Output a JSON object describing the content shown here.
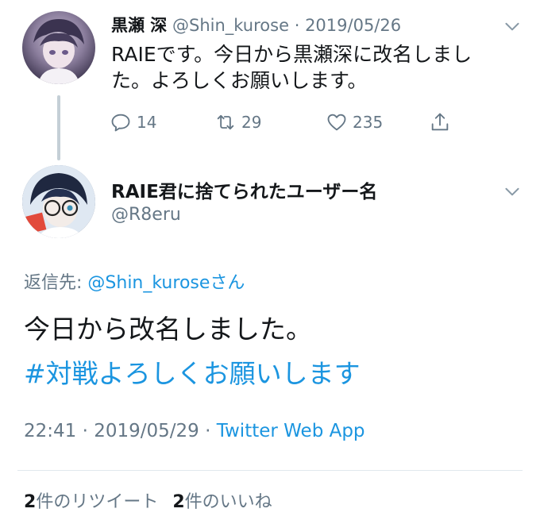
{
  "parent_tweet": {
    "author_name": "黒瀬 深",
    "handle": "@Shin_kurose",
    "separator": "·",
    "date": "2019/05/26",
    "text": "RAIEです。今日から黒瀬深に改名しました。よろしくお願いします。",
    "actions": {
      "replies": "14",
      "retweets": "29",
      "likes": "235"
    },
    "icons": [
      "reply-icon",
      "retweet-icon",
      "heart-icon",
      "share-icon",
      "chevron-down-icon"
    ]
  },
  "reply_tweet": {
    "author_name": "RAIE君に捨てられたユーザー名",
    "handle": "@R8eru",
    "reply_to_prefix": "返信先: ",
    "reply_to_mention": "@Shin_kurose",
    "reply_to_suffix": "さん",
    "text": "今日から改名しました。",
    "hashtag": "#対戦よろしくお願いします",
    "time": "22:41",
    "separator": "·",
    "date": "2019/05/29",
    "source": "Twitter Web App",
    "stats": {
      "retweet_count": "2",
      "retweet_label": "件のリツイート",
      "like_count": "2",
      "like_label": "件のいいね"
    }
  },
  "colors": {
    "link": "#1b95e0",
    "muted": "#657786",
    "text": "#14171a",
    "thread_line": "#c4cfd6"
  }
}
